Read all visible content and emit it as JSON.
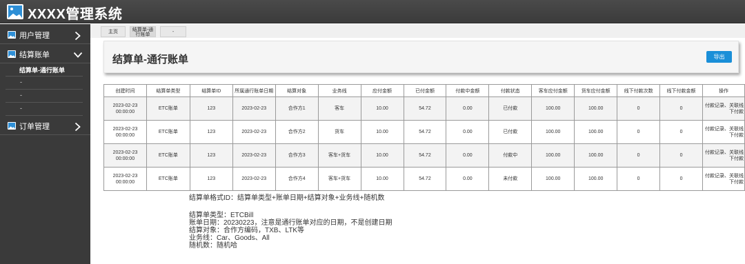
{
  "header": {
    "title": "XXXX管理系统"
  },
  "sidebar": {
    "user_menu": "用户管理",
    "settlement_menu": "结算账单",
    "settlement_sub": [
      "结算单-通行账单",
      "-",
      "-",
      "-"
    ],
    "order_menu": "订单管理"
  },
  "tabs": {
    "home": "主页",
    "active_line1": "结算单-通",
    "active_line2": "行账单",
    "extra": "-"
  },
  "page": {
    "title": "结算单-通行账单",
    "export_label": "导出"
  },
  "table": {
    "headers": [
      "创建时间",
      "结算单类型",
      "结算单ID",
      "所属通行账单日期",
      "结算对象",
      "业务线",
      "应付金额",
      "已付金额",
      "付款中金额",
      "付款状态",
      "客车应付金额",
      "货车应付金额",
      "线下付款次数",
      "线下付款金额",
      "操作"
    ],
    "rows": [
      {
        "created_date": "2023-02-23",
        "created_time": "00:00:00",
        "type": "ETC账单",
        "id": "123",
        "bill_date": "2023-02-23",
        "target": "合作方1",
        "line": "客车",
        "payable": "10.00",
        "paid": "54.72",
        "paying": "0.00",
        "status": "已付款",
        "bus_payable": "100.00",
        "truck_payable": "100.00",
        "offline_count": "0",
        "offline_amount": "0",
        "ops_line1": "付款记录、关联线",
        "ops_line2": "下付款"
      },
      {
        "created_date": "2023-02-23",
        "created_time": "00:00:00",
        "type": "ETC账单",
        "id": "123",
        "bill_date": "2023-02-23",
        "target": "合作方2",
        "line": "货车",
        "payable": "10.00",
        "paid": "54.72",
        "paying": "0.00",
        "status": "已付款",
        "bus_payable": "100.00",
        "truck_payable": "100.00",
        "offline_count": "0",
        "offline_amount": "0",
        "ops_line1": "付款记录、关联线",
        "ops_line2": "下付款"
      },
      {
        "created_date": "2023-02-23",
        "created_time": "00:00:00",
        "type": "ETC账单",
        "id": "123",
        "bill_date": "2023-02-23",
        "target": "合作方3",
        "line": "客车+货车",
        "payable": "10.00",
        "paid": "54.72",
        "paying": "0.00",
        "status": "付款中",
        "bus_payable": "100.00",
        "truck_payable": "100.00",
        "offline_count": "0",
        "offline_amount": "0",
        "ops_line1": "付款记录、关联线",
        "ops_line2": "下付款"
      },
      {
        "created_date": "2023-02-23",
        "created_time": "00:00:00",
        "type": "ETC账单",
        "id": "123",
        "bill_date": "2023-02-23",
        "target": "合作方4",
        "line": "客车+货车",
        "payable": "10.00",
        "paid": "54.72",
        "paying": "0.00",
        "status": "未付款",
        "bus_payable": "100.00",
        "truck_payable": "100.00",
        "offline_count": "0",
        "offline_amount": "0",
        "ops_line1": "付款记录、关联线",
        "ops_line2": "下付款"
      }
    ]
  },
  "notes": [
    "结算单格式ID：结算单类型+账单日期+结算对象+业务线+随机数",
    "",
    "结算单类型：ETCBill",
    "账单日期：20230223，注意是通行账单对应的日期，不是创建日期",
    "结算对象：合作方编码，TXB、LTK等",
    "业务线：Car、Goods、All",
    "随机数：随机哈"
  ]
}
